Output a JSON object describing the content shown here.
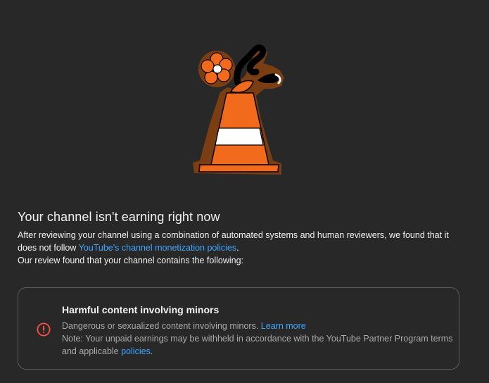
{
  "illustration": {
    "name": "traffic-cone-with-flower",
    "colors": {
      "cone": "#f26a1b",
      "stripe": "#ffffff",
      "outline": "#7a3e12",
      "ink": "#000000"
    }
  },
  "header": {
    "title": "Your channel isn't earning right now"
  },
  "description": {
    "line1_text": "After reviewing your channel using a combination of automated systems and human reviewers, we found that it does not follow ",
    "policy_link": "YouTube's channel monetization policies",
    "line1_end": ".",
    "line2": "Our review found that your channel contains the following:"
  },
  "violation_card": {
    "icon": "alert-circle-icon",
    "icon_color": "#ff4e45",
    "title": "Harmful content involving minors",
    "body_text": "Dangerous or sexualized content involving minors. ",
    "learn_more": "Learn more",
    "note_text": "Note: Your unpaid earnings may be withheld in accordance with the YouTube Partner Program terms and applicable ",
    "policies_link": "policies",
    "note_end": "."
  },
  "colors": {
    "background": "#282828",
    "link": "#3ea6ff",
    "border": "#5b5b5b"
  }
}
